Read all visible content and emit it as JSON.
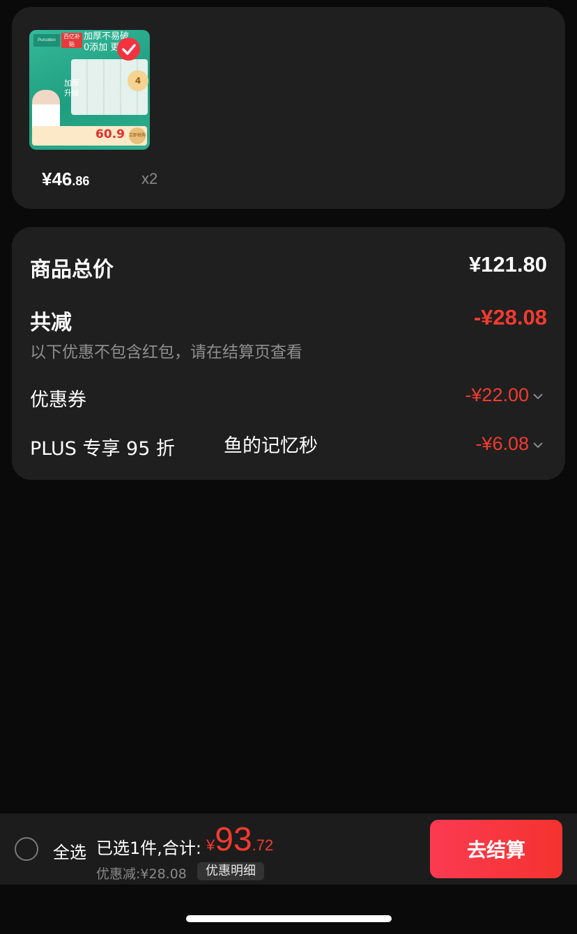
{
  "product": {
    "thumb_brand": "Purcotton",
    "thumb_tag": "百亿补贴",
    "thumb_headline": "加厚不易破",
    "thumb_sub": "0添加 更",
    "thumb_upgrade": "加厚升级",
    "thumb_price": "60.9",
    "thumb_badge": "立即抢购",
    "thumb_count": "4",
    "price_int": "¥46",
    "price_dec": ".86",
    "quantity": "x2"
  },
  "summary": {
    "total_label": "商品总价",
    "total_value": "¥121.80",
    "reduce_label": "共减",
    "reduce_value": "-¥28.08",
    "hint": "以下优惠不包含红包，请在结算页查看",
    "coupon_label": "优惠券",
    "coupon_value": "-¥22.00",
    "plus_label": "PLUS 专享 95 折",
    "plus_note": "鱼的记忆秒",
    "plus_value": "-¥6.08"
  },
  "bottom_bar": {
    "select_all": "全选",
    "selected_info": "已选1件,合计:",
    "currency": "¥",
    "total_int": "93",
    "total_dec": ".72",
    "saved": "优惠减:¥28.08",
    "detail_button": "优惠明细",
    "checkout_button": "去结算"
  },
  "colors": {
    "accent_red": "#f23b2f",
    "card_bg": "#1f1f1f",
    "page_bg": "#0a0a0a"
  }
}
